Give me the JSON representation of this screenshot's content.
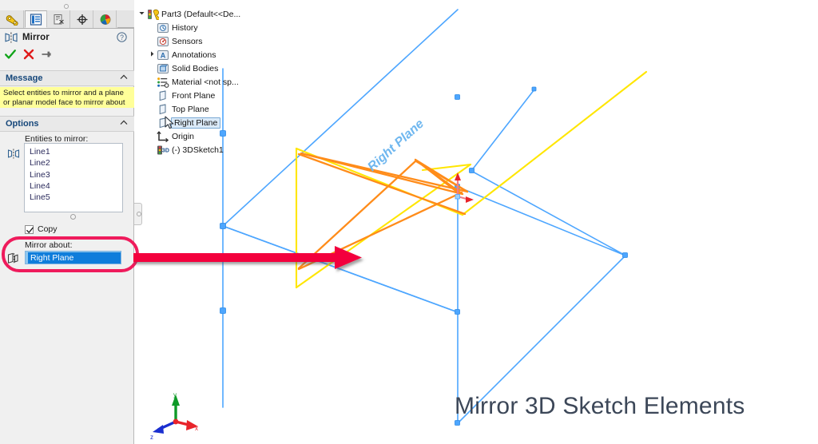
{
  "app": {
    "panel_title": "Mirror",
    "tabs": [
      {
        "name": "feature-manager",
        "title": "FeatureManager design tree",
        "active": false
      },
      {
        "name": "property-manager",
        "title": "PropertyManager",
        "active": true
      },
      {
        "name": "configuration-manager",
        "title": "ConfigurationManager",
        "active": false
      },
      {
        "name": "dimxpert-manager",
        "title": "DimXpertManager",
        "active": false
      },
      {
        "name": "display-manager",
        "title": "DisplayManager",
        "active": false
      }
    ],
    "actions": [
      {
        "name": "ok",
        "label": "OK"
      },
      {
        "name": "cancel",
        "label": "Cancel"
      },
      {
        "name": "keep-visible",
        "label": "Keep Visible"
      }
    ],
    "help_label": "Help"
  },
  "message": {
    "header": "Message",
    "lines": [
      "Select entities to mirror and a plane",
      "or planar model face to mirror about"
    ]
  },
  "options": {
    "header": "Options",
    "entities_label": "Entities to mirror:",
    "entities": [
      "Line1",
      "Line2",
      "Line3",
      "Line4",
      "Line5"
    ],
    "copy": {
      "label": "Copy",
      "checked": true
    },
    "mirror_about_label": "Mirror about:",
    "mirror_about_value": "Right Plane"
  },
  "tree": [
    {
      "label": "Part3  (Default<<De...",
      "icon": "part-icon",
      "indent": 0,
      "arrow": "collapse",
      "selected": false
    },
    {
      "label": "History",
      "icon": "history-icon",
      "indent": 1,
      "arrow": "",
      "selected": false
    },
    {
      "label": "Sensors",
      "icon": "sensors-icon",
      "indent": 1,
      "arrow": "",
      "selected": false
    },
    {
      "label": "Annotations",
      "icon": "annotations-icon",
      "indent": 1,
      "arrow": "expand",
      "selected": false
    },
    {
      "label": "Solid Bodies",
      "icon": "solid-bodies-icon",
      "indent": 1,
      "arrow": "",
      "selected": false
    },
    {
      "label": "Material <not sp...",
      "icon": "material-icon",
      "indent": 1,
      "arrow": "",
      "selected": false
    },
    {
      "label": "Front Plane",
      "icon": "plane-icon",
      "indent": 1,
      "arrow": "",
      "selected": false
    },
    {
      "label": "Top Plane",
      "icon": "plane-icon",
      "indent": 1,
      "arrow": "",
      "selected": false
    },
    {
      "label": "Right Plane",
      "icon": "plane-icon",
      "indent": 1,
      "arrow": "",
      "selected": true
    },
    {
      "label": "Origin",
      "icon": "origin-icon",
      "indent": 1,
      "arrow": "",
      "selected": false
    },
    {
      "label": "(-) 3DSketch1",
      "icon": "sketch3d-icon",
      "indent": 1,
      "arrow": "",
      "selected": false
    }
  ],
  "viewport": {
    "caption": "Mirror 3D Sketch Elements",
    "plane_label": "Right Plane",
    "triad_axes": [
      {
        "name": "x-axis",
        "label": "x",
        "color": "#e8232a"
      },
      {
        "name": "y-axis",
        "label": "y",
        "color": "#0e9a28"
      },
      {
        "name": "z-axis",
        "label": "z",
        "color": "#1a2fd0"
      }
    ]
  },
  "annotations": {
    "arrow_color": "#f3003c",
    "highlight_color": "#ef1b5c",
    "arrow_target": "mirror-about-field"
  },
  "colors": {
    "sketch_blue": "#4da6ff",
    "sketch_yellow": "#ffe600",
    "sketch_orange": "#ff8c1a",
    "selection_blue": "#0f7ddb",
    "message_yellow": "#ffff99",
    "section_header_text": "#16477a",
    "caption_text": "#3c4758"
  }
}
